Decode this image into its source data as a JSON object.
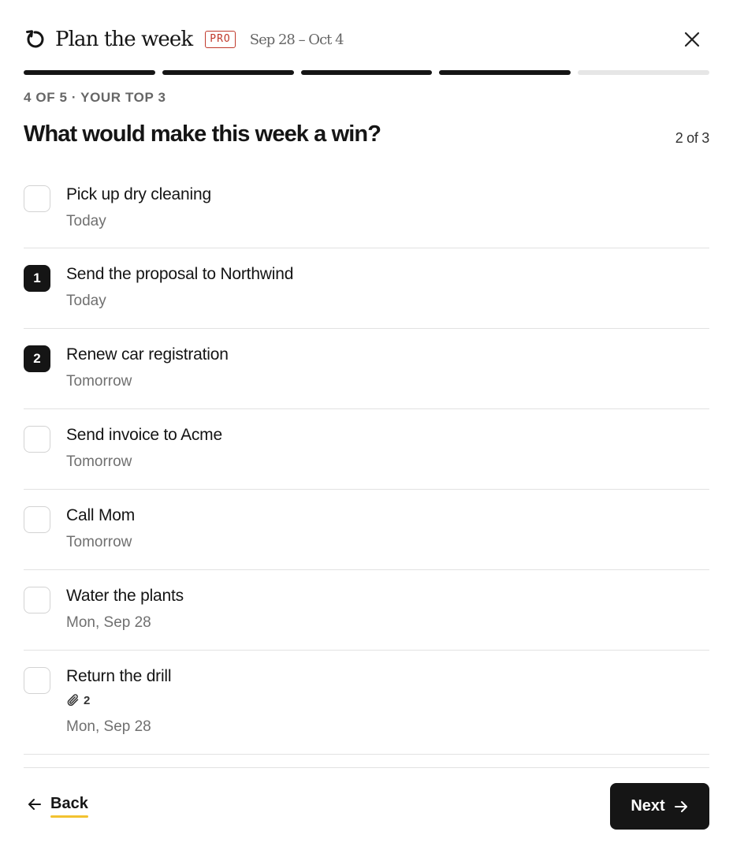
{
  "header": {
    "title": "Plan the week",
    "badge": "PRO",
    "date_range": "Sep 28 – Oct 4",
    "icons": {
      "refresh": "refresh-icon",
      "close": "close-icon"
    }
  },
  "progress": {
    "total_steps": 5,
    "completed_steps": 4,
    "active_color": "#151515",
    "inactive_color": "#e6e6e6"
  },
  "step": {
    "label": "4 OF 5 · YOUR TOP 3",
    "question": "What would make this week a win?",
    "counter": "2 of 3"
  },
  "tasks": [
    {
      "title": "Pick up dry cleaning",
      "date": "Today",
      "rank": null
    },
    {
      "title": "Send the proposal to Northwind",
      "date": "Today",
      "rank": "1"
    },
    {
      "title": "Renew car registration",
      "date": "Tomorrow",
      "rank": "2"
    },
    {
      "title": "Send invoice to Acme",
      "date": "Tomorrow",
      "rank": null
    },
    {
      "title": "Call Mom",
      "date": "Tomorrow",
      "rank": null
    },
    {
      "title": "Water the plants",
      "date": "Mon, Sep 28",
      "rank": null
    },
    {
      "title": "Return the drill",
      "date": "Mon, Sep 28",
      "rank": null,
      "attachments": "2",
      "attachment_icon": "paperclip-icon"
    }
  ],
  "footer": {
    "back_label": "Back",
    "next_label": "Next",
    "icons": {
      "back": "arrow-left-icon",
      "next": "arrow-right-icon"
    },
    "accent": "#f2c230"
  },
  "colors": {
    "brand_red": "#c0392b",
    "ink": "#151515",
    "muted": "#707070"
  }
}
